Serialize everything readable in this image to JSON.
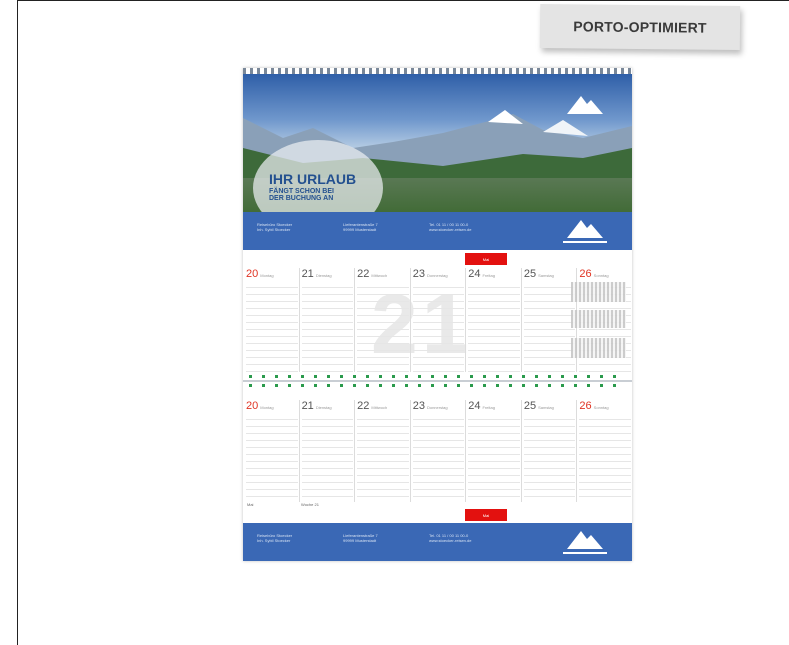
{
  "badge": {
    "label": "PORTO-OPTIMIERT"
  },
  "hero": {
    "headline": "IHR URLAUB",
    "line2": "FÄNGT SCHON BEI",
    "line3": "DER BUCHUNG AN",
    "brand": "REISEBÜRO STOECKER"
  },
  "band": {
    "col1": [
      "Reisebüro Stoecker",
      "Inh. Sybil Stoecker"
    ],
    "col2": [
      "Lieferantenstraße 7",
      "99999 Musterstadt"
    ],
    "col3": [
      "Tel. 01 11 / 00 11 00-0",
      "www.stoecker-reisen.de"
    ]
  },
  "calendar": {
    "month_tag": "Mai",
    "big_number": "21",
    "upper_days": [
      {
        "num": "20",
        "name": "Montag",
        "red": true
      },
      {
        "num": "21",
        "name": "Dienstag",
        "red": false
      },
      {
        "num": "22",
        "name": "Mittwoch",
        "red": false
      },
      {
        "num": "23",
        "name": "Donnerstag",
        "red": false
      },
      {
        "num": "24",
        "name": "Freitag",
        "red": false
      },
      {
        "num": "25",
        "name": "Samstag",
        "red": false
      },
      {
        "num": "26",
        "name": "Sonntag",
        "red": true
      }
    ],
    "lower_days": [
      {
        "num": "20",
        "name": "Montag",
        "red": true
      },
      {
        "num": "21",
        "name": "Dienstag",
        "red": false
      },
      {
        "num": "22",
        "name": "Mittwoch",
        "red": false
      },
      {
        "num": "23",
        "name": "Donnerstag",
        "red": false
      },
      {
        "num": "24",
        "name": "Freitag",
        "red": false
      },
      {
        "num": "25",
        "name": "Samstag",
        "red": false
      },
      {
        "num": "26",
        "name": "Sonntag",
        "red": true
      }
    ],
    "footer_left": "Mai",
    "footer_mid": "Woche 21"
  },
  "colors": {
    "accent_blue": "#3a68b5",
    "accent_red": "#e3110f"
  }
}
